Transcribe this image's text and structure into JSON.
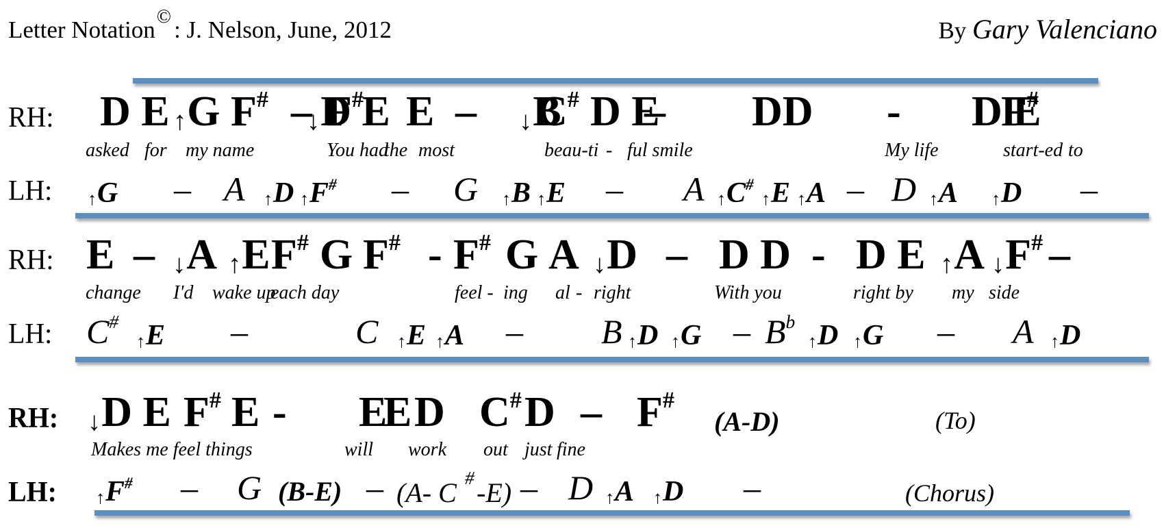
{
  "header": {
    "title": "Letter Notation",
    "copyright_symbol": "©",
    "attribution": ": J. Nelson, June, 2012",
    "by_label": "By",
    "artist": "Gary Valenciano"
  },
  "accent_color": "#5b8fc2",
  "hand_labels": {
    "right": "RH:",
    "left": "LH:"
  },
  "arrows": {
    "up": "↑",
    "down": "↓"
  },
  "sections": [
    {
      "rh": [
        {
          "t": "D E"
        },
        {
          "arrow": "up",
          "t": "G"
        },
        {
          "t": "F",
          "acc": "#"
        },
        {
          "t": "–"
        },
        {
          "arrow": "down",
          "t": "D E"
        },
        {
          "t": "F",
          "acc": "#"
        },
        {
          "t": "E"
        },
        {
          "t": "–"
        },
        {
          "arrow": "down",
          "t": "B"
        },
        {
          "t": "C",
          "acc": "#"
        },
        {
          "t": "D E"
        },
        {
          "t": "–"
        },
        {
          "t": "DD"
        },
        {
          "t": "-"
        },
        {
          "t": "D E"
        },
        {
          "t": "F",
          "acc": "#"
        }
      ],
      "lyrics": [
        "asked",
        "for",
        "my name",
        "You had",
        "the",
        "most",
        "beau-ti",
        "-",
        "ful smile",
        "My life",
        "start-ed",
        "to"
      ],
      "lh": [
        {
          "arrow": "up",
          "t": "G",
          "small": true
        },
        {
          "t": "–"
        },
        {
          "t": "A"
        },
        {
          "arrow": "up",
          "t": "D",
          "small": true
        },
        {
          "arrow": "up",
          "t": "F",
          "acc": "#",
          "small": true
        },
        {
          "t": "–"
        },
        {
          "t": "G"
        },
        {
          "arrow": "up",
          "t": "B",
          "small": true
        },
        {
          "arrow": "up",
          "t": "E",
          "small": true
        },
        {
          "t": "–"
        },
        {
          "t": "A"
        },
        {
          "arrow": "up",
          "t": "C",
          "acc": "#",
          "small": true
        },
        {
          "arrow": "up",
          "t": "E",
          "small": true
        },
        {
          "arrow": "up",
          "t": "A",
          "small": true
        },
        {
          "t": "–"
        },
        {
          "t": "D"
        },
        {
          "arrow": "up",
          "t": "A",
          "small": true
        },
        {
          "arrow": "up",
          "t": "D",
          "small": true
        },
        {
          "t": "–"
        }
      ]
    },
    {
      "rh": [
        {
          "t": "E"
        },
        {
          "t": "–"
        },
        {
          "arrow": "down",
          "t": "A"
        },
        {
          "arrow": "up",
          "t": "E"
        },
        {
          "t": "F",
          "acc": "#"
        },
        {
          "t": "G"
        },
        {
          "t": "F",
          "acc": "#"
        },
        {
          "t": "-"
        },
        {
          "t": "F",
          "acc": "#"
        },
        {
          "t": "G"
        },
        {
          "t": "A"
        },
        {
          "arrow": "down",
          "t": "D"
        },
        {
          "t": "–"
        },
        {
          "t": "D D"
        },
        {
          "t": "-"
        },
        {
          "t": "D E"
        },
        {
          "arrow": "up",
          "t": "A"
        },
        {
          "arrow": "down",
          "t": "F",
          "acc": "#"
        },
        {
          "t": "–"
        }
      ],
      "lyrics": [
        "change",
        "I'd",
        "wake up",
        "each day",
        "feel -",
        "ing",
        "al",
        "-",
        "right",
        "With you",
        "right by",
        "my",
        "side"
      ],
      "lh": [
        {
          "t": "C",
          "acc": "#"
        },
        {
          "arrow": "up",
          "t": "E",
          "small": true
        },
        {
          "t": "–"
        },
        {
          "t": "C"
        },
        {
          "arrow": "up",
          "t": "E",
          "small": true
        },
        {
          "arrow": "up",
          "t": "A",
          "small": true
        },
        {
          "t": "–"
        },
        {
          "t": "B"
        },
        {
          "arrow": "up",
          "t": "D",
          "small": true
        },
        {
          "arrow": "up",
          "t": "G",
          "small": true
        },
        {
          "t": "–"
        },
        {
          "t": "B",
          "acc": "b"
        },
        {
          "arrow": "up",
          "t": "D",
          "small": true
        },
        {
          "arrow": "up",
          "t": "G",
          "small": true
        },
        {
          "t": "–"
        },
        {
          "t": "A"
        },
        {
          "arrow": "up",
          "t": "D",
          "small": true
        }
      ]
    },
    {
      "rh": [
        {
          "arrow": "down",
          "t": "D E"
        },
        {
          "t": "F",
          "acc": "#"
        },
        {
          "t": "E"
        },
        {
          "t": "-"
        },
        {
          "t": "E"
        },
        {
          "t": "E"
        },
        {
          "t": "D"
        },
        {
          "t": "C",
          "acc": "#"
        },
        {
          "t": "D"
        },
        {
          "t": "–"
        },
        {
          "t": "F",
          "acc": "#"
        },
        {
          "t": "(A-D)",
          "paren": true
        }
      ],
      "rh_note": "(To)",
      "lyrics": [
        "Makes me feel things",
        "will",
        "work",
        "out",
        "just",
        "fine"
      ],
      "lh": [
        {
          "arrow": "up",
          "t": "F",
          "acc": "#",
          "small": true
        },
        {
          "t": "–"
        },
        {
          "t": "G"
        },
        {
          "t": "(B-E)",
          "paren": true,
          "small": true
        },
        {
          "t": "–"
        },
        {
          "t": "(A- C",
          "paren": true
        },
        {
          "t": "#",
          "acc_only": true
        },
        {
          "t": "-E)",
          "paren": true
        },
        {
          "t": "–"
        },
        {
          "t": "D"
        },
        {
          "arrow": "up",
          "t": "A",
          "small": true
        },
        {
          "arrow": "up",
          "t": "D",
          "small": true
        },
        {
          "t": "–"
        }
      ],
      "lh_note": "(Chorus)"
    }
  ]
}
